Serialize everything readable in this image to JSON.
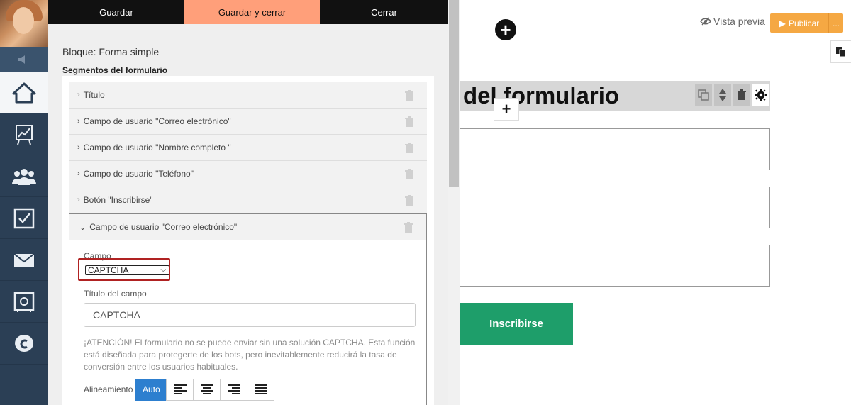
{
  "panel": {
    "buttons": {
      "save": "Guardar",
      "save_close": "Guardar y cerrar",
      "close": "Cerrar"
    },
    "block_title": "Bloque: Forma simple",
    "segments_title": "Segmentos del formulario",
    "segments": [
      {
        "label": "Título"
      },
      {
        "label": "Campo de usuario \"Correo electrónico\""
      },
      {
        "label": "Campo de usuario \"Nombre completo \""
      },
      {
        "label": "Campo de usuario \"Teléfono\""
      },
      {
        "label": "Botón \"Inscribirse\""
      }
    ],
    "expanded": {
      "header": "Campo de usuario \"Correo electrónico\"",
      "field_label": "Campo",
      "field_value": "CAPTCHA",
      "title_label": "Título del campo",
      "title_value": "CAPTCHA",
      "warning": "¡ATENCIÓN! El formulario no se puede enviar sin una solución CAPTCHA. Esta función está diseñada para protegerte de los bots, pero inevitablemente reducirá la tasa de conversión entre los usuarios habituales.",
      "alignment_label": "Alineamiento",
      "alignment_auto": "Auto"
    }
  },
  "canvas": {
    "preview": "Vista previa",
    "publish": "Publicar",
    "publish_more": "...",
    "heading": "del formulario",
    "submit": "Inscribirse",
    "plus": "+"
  },
  "colors": {
    "nav_bg": "#2b3f55",
    "accent_orange": "#ff9f7a",
    "publish": "#f5a843",
    "submit": "#1e9e6a",
    "auto_btn": "#2d7fcf",
    "highlight": "#b02222"
  },
  "icons": {
    "nav": [
      "home-icon",
      "chart-icon",
      "users-icon",
      "tasks-icon",
      "mail-icon",
      "safe-icon",
      "chat-icon"
    ]
  }
}
